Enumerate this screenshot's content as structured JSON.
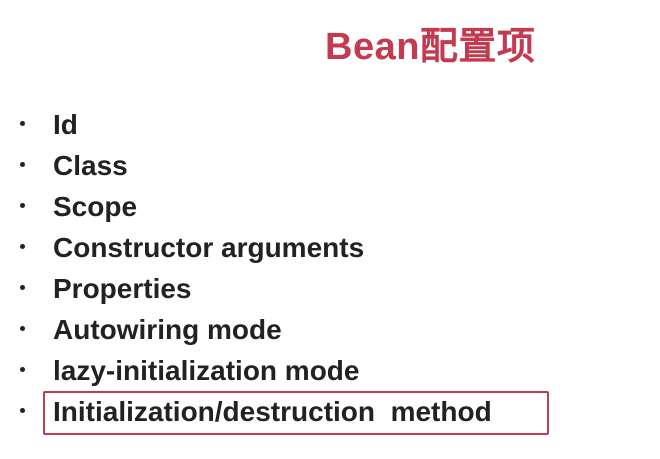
{
  "slide": {
    "title": "Bean配置项",
    "items": [
      "Id",
      "Class",
      "Scope",
      "Constructor arguments",
      "Properties",
      "Autowiring mode",
      "lazy-initialization mode",
      "Initialization/destruction  method"
    ],
    "highlighted_item_index": 7
  },
  "colors": {
    "title": "#c33b50",
    "text": "#222222",
    "highlight_border": "#c33b50",
    "background": "#ffffff"
  }
}
